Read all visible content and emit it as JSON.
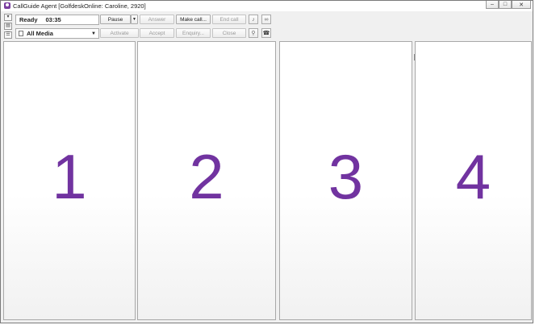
{
  "window": {
    "title": "CallGuide Agent [GolfdeskOnline: Caroline, 2920]"
  },
  "status": {
    "state": "Ready",
    "time": "03:35"
  },
  "media": {
    "selected": "All Media"
  },
  "buttons": {
    "pause": "Pause",
    "answer": "Answer",
    "make_call": "Make call...",
    "end_call": "End call",
    "activate": "Activate",
    "accept": "Accept",
    "enquiry": "Enquiry...",
    "close": "Close"
  },
  "panes": [
    {
      "label": "1"
    },
    {
      "label": "2"
    },
    {
      "label": "3"
    },
    {
      "label": "4"
    }
  ],
  "colors": {
    "pane_number": "#7133a0",
    "app_icon": "#7b3fa0"
  }
}
